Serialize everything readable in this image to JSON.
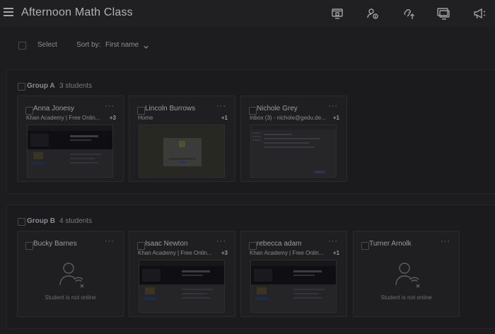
{
  "header": {
    "title": "Afternoon Math Class",
    "icons": [
      "menu-icon",
      "screen-lock-icon",
      "share-people-icon",
      "open-link-icon",
      "present-screen-icon",
      "announce-icon"
    ]
  },
  "toolbar": {
    "select_label": "Select",
    "sort_label": "Sort by:",
    "sort_value": "First name"
  },
  "groups": [
    {
      "name": "Group A",
      "count": "3 students",
      "students": [
        {
          "name": "Anna Jonesy",
          "tab": "Khan Academy | Free Onlin...",
          "tab_count": "+3",
          "thumb": "khan"
        },
        {
          "name": "Lincoln Burrows",
          "tab": "Home",
          "tab_count": "+1",
          "thumb": "home"
        },
        {
          "name": "Nichole Grey",
          "tab": "Inbox (3) - nichole@gedu.de...",
          "tab_count": "+1",
          "thumb": "mail"
        }
      ]
    },
    {
      "name": "Group B",
      "count": "4 students",
      "students": [
        {
          "name": "Bucky Barnes",
          "status": "Student is not online"
        },
        {
          "name": "Isaac Newton",
          "tab": "Khan Academy | Free Onlin...",
          "tab_count": "+3",
          "thumb": "khan"
        },
        {
          "name": "rebecca adam",
          "tab": "Khan Academy | Free Onlin...",
          "tab_count": "+1",
          "thumb": "khan"
        },
        {
          "name": "Turner Arnolk",
          "status": "Student is not online"
        }
      ]
    }
  ],
  "more_glyph": "···"
}
